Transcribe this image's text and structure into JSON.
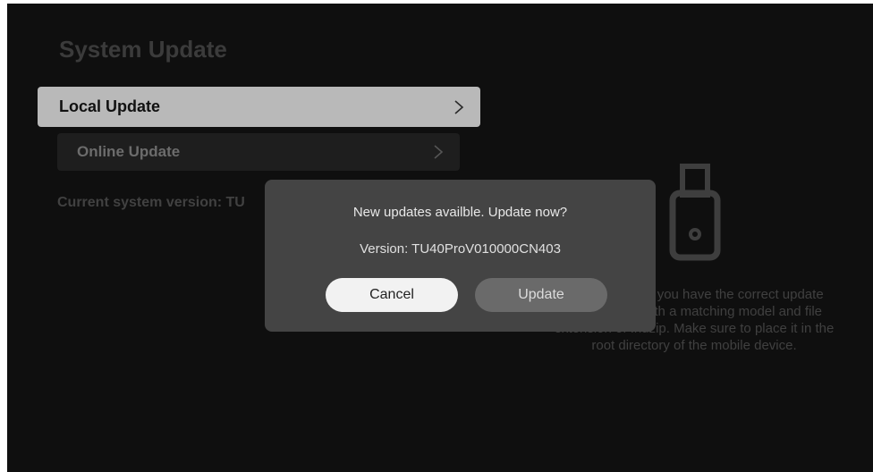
{
  "page": {
    "title": "System Update"
  },
  "menu": {
    "items": [
      {
        "label": "Local Update",
        "focused": true,
        "icon": "chevron-right-icon"
      },
      {
        "label": "Online Update",
        "focused": false,
        "icon": "chevron-right-icon"
      }
    ]
  },
  "current_version_label": "Current system version: TU",
  "right_panel": {
    "icon": "usb-drive-icon",
    "hint": "Make sure that you have the correct update package file with a matching model and file extension of .nuzip. Make sure to place it in the root directory of the mobile device."
  },
  "dialog": {
    "message": "New updates availble. Update now?",
    "version": "Version: TU40ProV010000CN403",
    "buttons": {
      "cancel_label": "Cancel",
      "update_label": "Update"
    }
  },
  "colors": {
    "background": "#0f0f0f",
    "focused_item": "#b9b9b9",
    "dialog": "#444444"
  }
}
